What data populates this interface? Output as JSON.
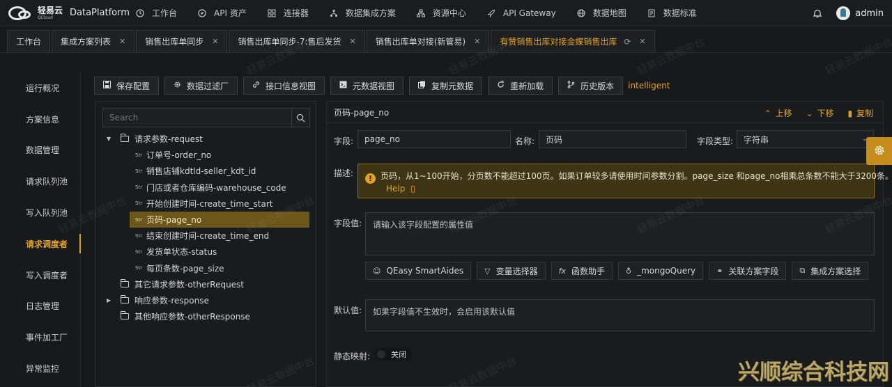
{
  "header": {
    "brand_cn": "轻易云",
    "brand_en": "QCloud",
    "platform": "DataPlatform",
    "nav": [
      {
        "label": "工作台",
        "icon": "clock-icon"
      },
      {
        "label": "API 资产",
        "icon": "compass-icon"
      },
      {
        "label": "连接器",
        "icon": "grid-icon"
      },
      {
        "label": "数据集成方案",
        "icon": "network-icon"
      },
      {
        "label": "资源中心",
        "icon": "tree-icon"
      },
      {
        "label": "API Gateway",
        "icon": "rocket-icon"
      },
      {
        "label": "数据地图",
        "icon": "globe-icon"
      },
      {
        "label": "数据标准",
        "icon": "document-icon"
      }
    ],
    "user": "admin"
  },
  "tabs": [
    {
      "label": "工作台",
      "closable": false
    },
    {
      "label": "集成方案列表",
      "closable": true
    },
    {
      "label": "销售出库单同步",
      "closable": true
    },
    {
      "label": "销售出库单同步-7:售后发货",
      "closable": true
    },
    {
      "label": "销售出库单对接(新管易)",
      "closable": true
    },
    {
      "label": "有赞销售出库对接金蝶销售出库",
      "closable": true,
      "active": true
    }
  ],
  "sidebar": {
    "items": [
      {
        "label": "运行概况"
      },
      {
        "label": "方案信息"
      },
      {
        "label": "数据管理"
      },
      {
        "label": "请求队列池"
      },
      {
        "label": "写入队列池"
      },
      {
        "label": "请求调度者",
        "active": true
      },
      {
        "label": "写入调度者"
      },
      {
        "label": "日志管理"
      },
      {
        "label": "事件加工厂"
      },
      {
        "label": "异常监控"
      }
    ]
  },
  "toolbar": {
    "buttons": [
      {
        "label": "保存配置",
        "icon": "save-icon"
      },
      {
        "label": "数据过滤厂",
        "icon": "gear-icon"
      },
      {
        "label": "接口信息视图",
        "icon": "link-icon"
      },
      {
        "label": "元数据视图",
        "icon": "terminal-icon"
      },
      {
        "label": "复制元数据",
        "icon": "copy-icon"
      },
      {
        "label": "重新加载",
        "icon": "refresh-icon"
      },
      {
        "label": "历史版本",
        "icon": "branch-icon"
      }
    ],
    "tag": "intelligent"
  },
  "tree": {
    "search_placeholder": "Search",
    "str_badge": "Str",
    "nodes": [
      {
        "label": "请求参数-request",
        "type": "folder",
        "level": 1,
        "expanded": true
      },
      {
        "label": "订单号-order_no",
        "type": "string",
        "level": 2
      },
      {
        "label": "销售店铺kdtld-seller_kdt_id",
        "type": "string",
        "level": 2
      },
      {
        "label": "门店或者仓库编码-warehouse_code",
        "type": "string",
        "level": 2
      },
      {
        "label": "开始创建时间-create_time_start",
        "type": "string",
        "level": 2
      },
      {
        "label": "页码-page_no",
        "type": "string",
        "level": 2,
        "selected": true
      },
      {
        "label": "结束创建时间-create_time_end",
        "type": "string",
        "level": 2
      },
      {
        "label": "发货单状态-status",
        "type": "string",
        "level": 2
      },
      {
        "label": "每页条数-page_size",
        "type": "string",
        "level": 2
      },
      {
        "label": "其它请求参数-otherRequest",
        "type": "folder",
        "level": 1
      },
      {
        "label": "响应参数-response",
        "type": "folder",
        "level": 1,
        "collapsed": true
      },
      {
        "label": "其他响应参数-otherResponse",
        "type": "folder",
        "level": 1
      }
    ]
  },
  "detail": {
    "title": "页码-page_no",
    "actions": {
      "up": "上移",
      "down": "下移",
      "copy": "复制"
    },
    "field_label": "字段:",
    "field_value": "page_no",
    "name_label": "名称:",
    "name_value": "页码",
    "type_label": "字段类型:",
    "type_value": "字符串",
    "desc_label": "描述:",
    "desc_text": "页码，从1~100开始，分页数不能超过100页。如果订单较多请使用时间参数分割。page_size 和page_no相乘总条数不能大于3200条。",
    "desc_help": "Help",
    "value_label": "字段值:",
    "value_placeholder": "请输入该字段配置的属性值",
    "helpers": [
      {
        "label": "QEasy SmartAides",
        "icon": "robot-icon"
      },
      {
        "label": "变量选择器",
        "icon": "filter-icon"
      },
      {
        "label": "函数助手",
        "icon": "function-icon"
      },
      {
        "label": "_mongoQuery",
        "icon": "bulb-icon"
      },
      {
        "label": "关联方案字段",
        "icon": "link-icon"
      },
      {
        "label": "集成方案选择",
        "icon": "blocks-icon"
      }
    ],
    "default_label": "默认值:",
    "default_placeholder": "如果字段值不生效时，会启用该默认值",
    "static_label": "静态映射:",
    "static_toggle": "关闭"
  },
  "watermark": {
    "text": "轻易云数据中台",
    "corner": "兴顺综合科技网"
  },
  "colors": {
    "accent": "#e3a32a",
    "selected_row": "#6b571a",
    "warning_bg": "#3d3516"
  }
}
